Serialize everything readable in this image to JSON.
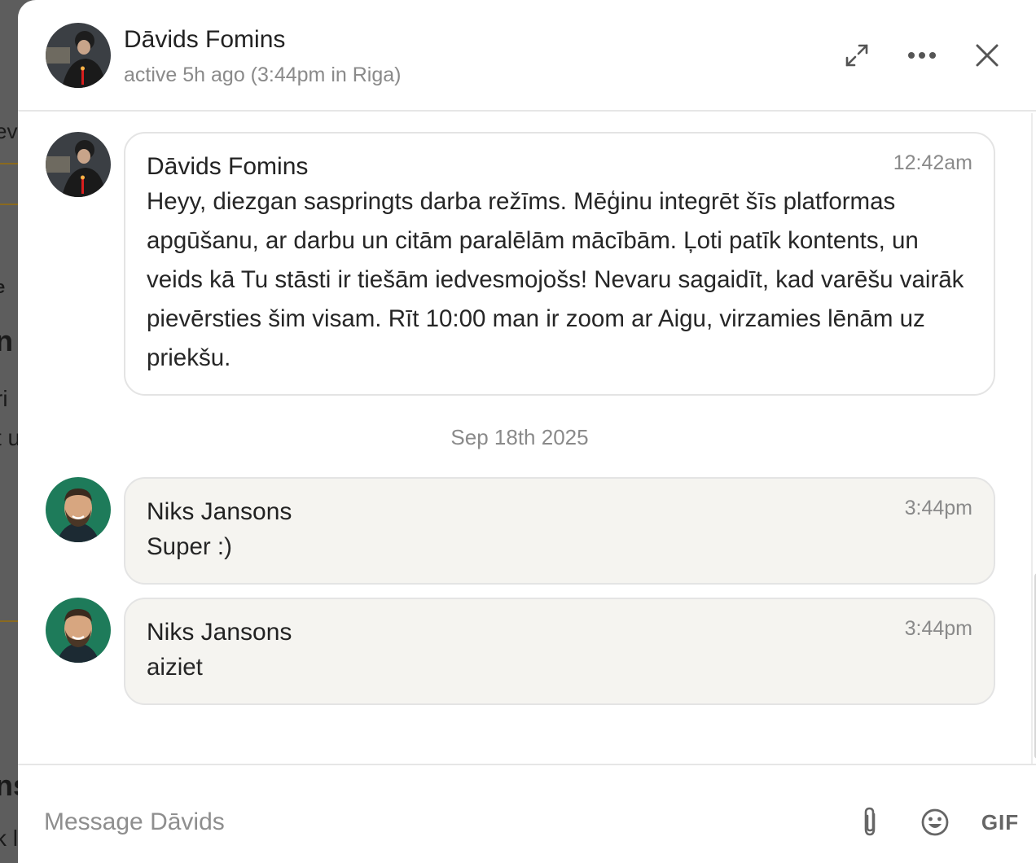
{
  "header": {
    "name": "Dāvids Fomins",
    "status": "active 5h ago (3:44pm in Riga)",
    "icons": {
      "expand": "expand-icon",
      "more": "more-icon",
      "close": "close-icon"
    }
  },
  "background_fragments": [
    "ev",
    "e",
    "n",
    "ri",
    "t u",
    "ns",
    "k l"
  ],
  "messages": [
    {
      "author": "Dāvids Fomins",
      "time": "12:42am",
      "text": "Heyy, diezgan saspringts darba režīms. Mēģinu integrēt šīs platformas apgūšanu, ar darbu un citām paralēlām mācībām. Ļoti patīk kontents, un veids kā Tu stāsti ir tiešām iedvesmojošs! Nevaru sagaidīt, kad varēšu vairāk pievērsties šim visam. Rīt 10:00 man ir zoom ar Aigu, virzamies lēnām uz priekšu."
    },
    {
      "author": "Niks Jansons",
      "time": "3:44pm",
      "text": "Super :)"
    },
    {
      "author": "Niks Jansons",
      "time": "3:44pm",
      "text": "aiziet"
    }
  ],
  "date_separator": "Sep 18th 2025",
  "composer": {
    "placeholder": "Message Dāvids",
    "gif_label": "GIF",
    "icons": {
      "attach": "paperclip-icon",
      "emoji": "emoji-icon"
    }
  },
  "colors": {
    "accent_bubble": "#f5f4f0",
    "border": "#e4e4e4",
    "muted_text": "#8a8a8a",
    "avatar_bg_niks": "#1e7b5a"
  }
}
